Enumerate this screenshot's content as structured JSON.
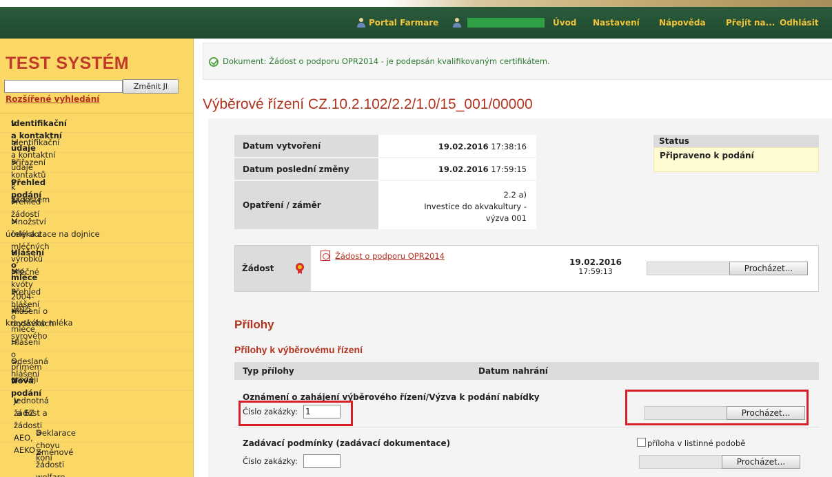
{
  "header": {
    "portal_label": "Portal Farmare",
    "nav": [
      "Úvod",
      "Nastavení",
      "Nápověda",
      "Přejít na...",
      "Odhlásit"
    ]
  },
  "sidebar": {
    "system_title": "TEST SYSTÉM",
    "search_button": "Změnit JI",
    "advanced_search": "Rozšířené vyhledání",
    "items": [
      {
        "label": "Identifikační a kontaktní údaje",
        "type": "section"
      },
      {
        "label": "Identifikační a kontaktní údaje",
        "type": "item"
      },
      {
        "label": "Přiřazení kontaktů k žádostem",
        "type": "item"
      },
      {
        "label": "Přehled podání",
        "type": "section"
      },
      {
        "label": "Přehled žádostí",
        "type": "item"
      },
      {
        "label": "Množství mléka z mléčných výrobků pro",
        "label2": "účely dotace na dojnice",
        "type": "item"
      },
      {
        "label": "Hlášení o mléce",
        "type": "section"
      },
      {
        "label": "Mléčné kvóty 2004-2015",
        "type": "item"
      },
      {
        "label": "Přehled hlášení o mléce",
        "type": "item"
      },
      {
        "label": "Hlášení o dodávkách syrového",
        "label2": "kravského mléka",
        "type": "item"
      },
      {
        "label": "Hlášení o přímém prodeji",
        "type": "item"
      },
      {
        "label": "Odeslaná hlášení",
        "type": "item"
      },
      {
        "label": "Nová podání",
        "type": "section"
      },
      {
        "label": "Jednotná žádost a žádosti AEO, AEKO",
        "label2": "a EZ",
        "type": "item"
      },
      {
        "label": "Deklarace chovu koní",
        "type": "subitem"
      },
      {
        "label": "Změnové žádosti welfare",
        "type": "subitem"
      }
    ]
  },
  "message": "Dokument: Žádost o podporu OPR2014 - je podepsán kvalifikovaným certifikátem.",
  "page_title": "Výběrové řízení CZ.10.2.102/2.2/1.0/15_001/00000",
  "info": {
    "created_label": "Datum vytvoření",
    "created_date": "19.02.2016",
    "created_time": "17:38:16",
    "changed_label": "Datum poslední změny",
    "changed_date": "19.02.2016",
    "changed_time": "17:59:15",
    "measure_label": "Opatření / záměr",
    "measure_line1": "2.2 a)",
    "measure_line2": "Investice do akvakultury -",
    "measure_line3": "výzva 001"
  },
  "status": {
    "header": "Status",
    "value": "Připraveno k podání"
  },
  "zadost": {
    "label": "Žádost",
    "link": "Žádost o podporu OPR2014",
    "date": "19.02.2016",
    "time": "17:59:13",
    "browse": "Procházet..."
  },
  "attachments": {
    "title": "Přílohy",
    "subtitle": "Přílohy k výběrovému řízení",
    "col_type": "Typ přílohy",
    "col_date": "Datum nahrání",
    "rows": [
      {
        "title": "Oznámení o zahájení výběrového řízení/Výzva k podání nabídky",
        "number_label": "Číslo zakázky:",
        "number_value": "1",
        "browse": "Procházet..."
      },
      {
        "title": "Zadávací podmínky (zadávací dokumentace)",
        "number_label": "Číslo zakázky:",
        "number_value": "",
        "paper_label": "příloha v listinné podobě",
        "browse": "Procházet..."
      }
    ]
  }
}
